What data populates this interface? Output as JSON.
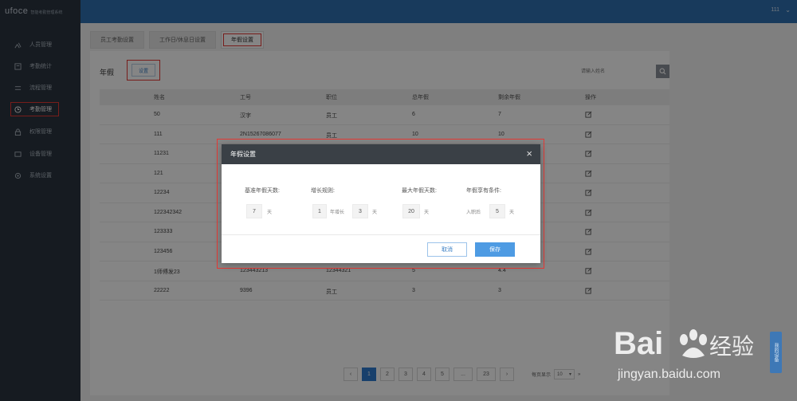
{
  "app": {
    "brand": "ufoce",
    "system_name": "智能考勤管理系统"
  },
  "header": {
    "user": "111"
  },
  "sidebar": {
    "items": [
      {
        "label": "人员管理",
        "icon": "people-icon"
      },
      {
        "label": "考勤统计",
        "icon": "stats-icon"
      },
      {
        "label": "流程管理",
        "icon": "flow-icon"
      },
      {
        "label": "考勤管理",
        "icon": "clock-icon",
        "active": true
      },
      {
        "label": "权限管理",
        "icon": "lock-icon"
      },
      {
        "label": "设备管理",
        "icon": "device-icon"
      },
      {
        "label": "系统设置",
        "icon": "gear-icon"
      }
    ]
  },
  "tabs": [
    {
      "label": "员工考勤设置"
    },
    {
      "label": "工作日/休息日设置"
    },
    {
      "label": "年假设置",
      "active": true
    }
  ],
  "section": {
    "title": "年假",
    "settings_button": "设置",
    "search_placeholder": "请输入姓名"
  },
  "table": {
    "columns": [
      "姓名",
      "工号",
      "职位",
      "总年假",
      "剩余年假",
      "操作"
    ],
    "rows": [
      {
        "name": "50",
        "id": "汉字",
        "position": "员工",
        "total": "6",
        "remain": "7"
      },
      {
        "name": "111",
        "id": "2N15267086077",
        "position": "员工",
        "total": "10",
        "remain": "10"
      },
      {
        "name": "11231",
        "id": "",
        "position": "",
        "total": "",
        "remain": ""
      },
      {
        "name": "121",
        "id": "",
        "position": "",
        "total": "",
        "remain": ""
      },
      {
        "name": "12234",
        "id": "",
        "position": "",
        "total": "",
        "remain": ""
      },
      {
        "name": "122342342",
        "id": "",
        "position": "",
        "total": "",
        "remain": ""
      },
      {
        "name": "123333",
        "id": "",
        "position": "",
        "total": "",
        "remain": ""
      },
      {
        "name": "123456",
        "id": "",
        "position": "",
        "total": "",
        "remain": ""
      },
      {
        "name": "1师傅发23",
        "id": "123443213",
        "position": "12344321",
        "total": "5",
        "remain": "4.4"
      },
      {
        "name": "22222",
        "id": "9396",
        "position": "员工",
        "total": "3",
        "remain": "3"
      }
    ]
  },
  "pagination": {
    "prev": "‹",
    "pages": [
      "1",
      "2",
      "3",
      "4",
      "5",
      "...",
      "23"
    ],
    "next": "›",
    "per_page_label": "每页显示",
    "per_page_value": "10",
    "last": "»"
  },
  "modal": {
    "title": "年假设置",
    "fields": {
      "base_label": "基准年假天数:",
      "base_value": "7",
      "base_unit": "天",
      "growth_label": "增长规则:",
      "growth_value1": "1",
      "growth_mid": "年增长",
      "growth_value2": "3",
      "growth_unit": "天",
      "max_label": "最大年假天数:",
      "max_value": "20",
      "max_unit": "天",
      "cond_label": "年假享有条件:",
      "cond_prefix": "入职后",
      "cond_value": "5",
      "cond_unit": "天"
    },
    "cancel": "取消",
    "save": "保存"
  },
  "watermark": {
    "brand": "Bai",
    "brand2": "经验",
    "site": "jingyan.baidu.com"
  },
  "side_tab": {
    "label": "我的设备"
  },
  "colors": {
    "sidebar": "#2b3440",
    "header": "#2f6fb0",
    "primary": "#4e9be3",
    "highlight": "#e53935"
  }
}
